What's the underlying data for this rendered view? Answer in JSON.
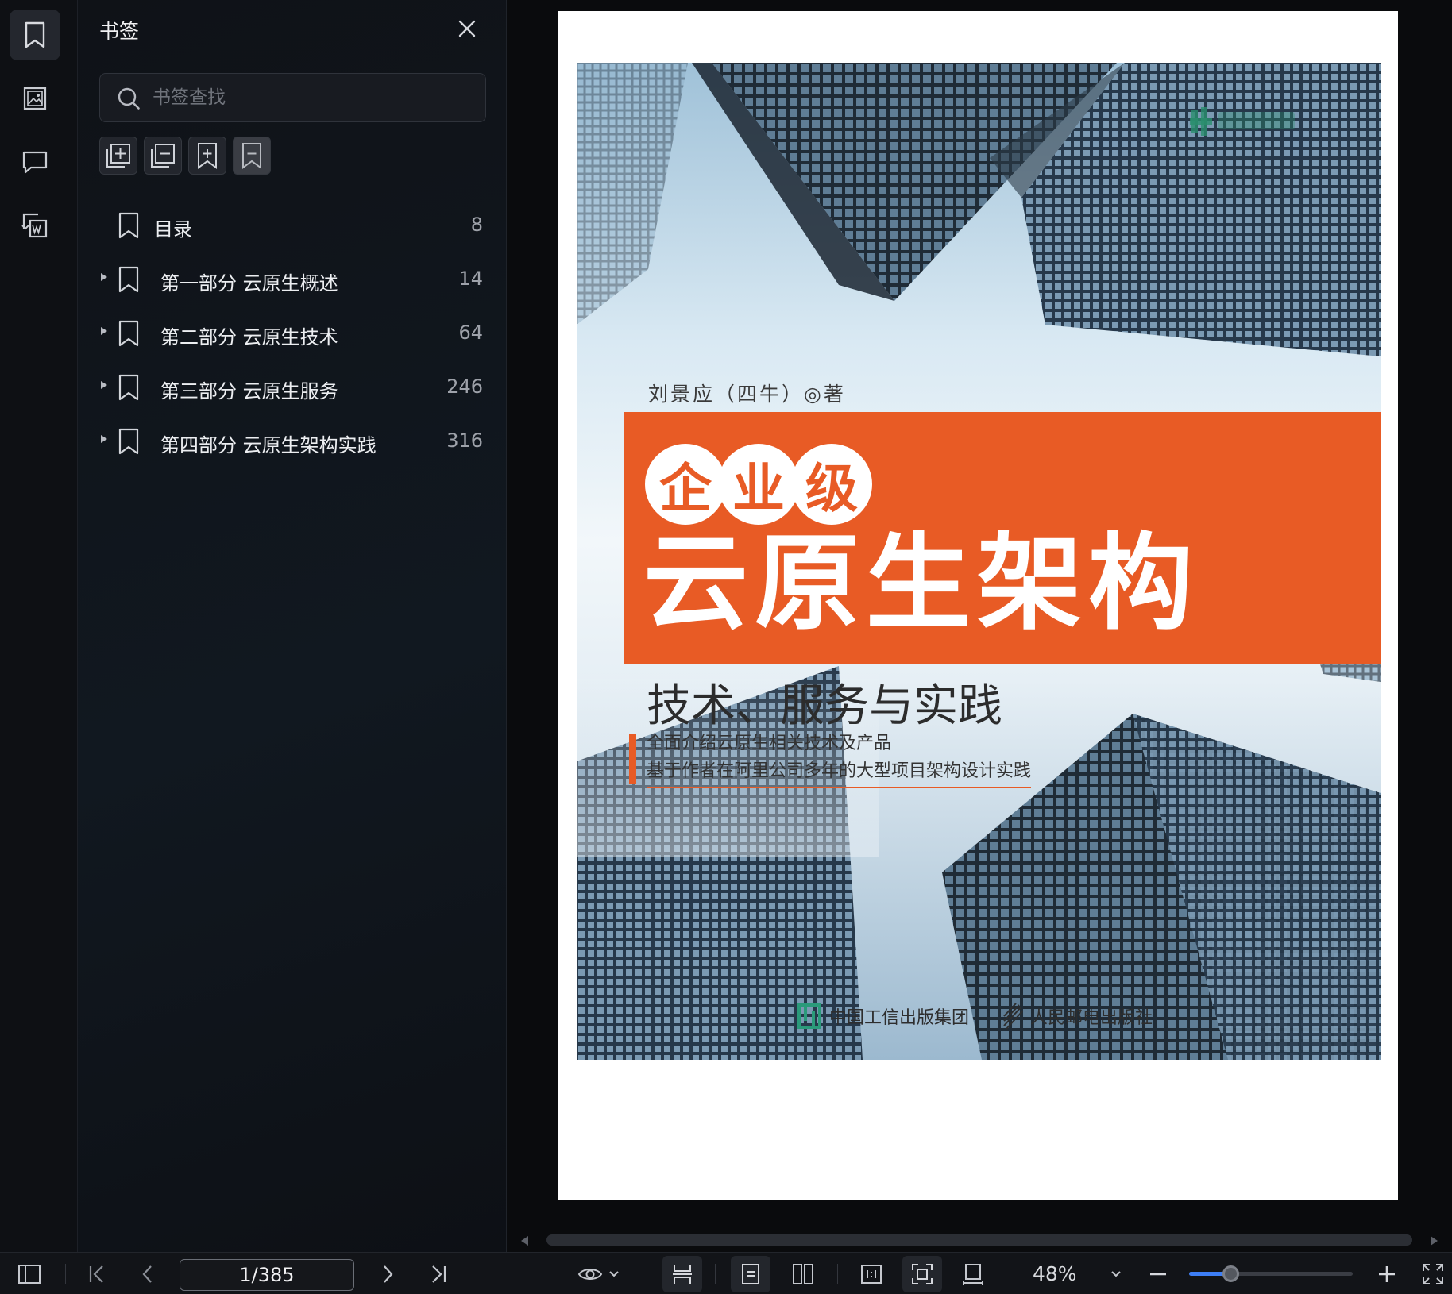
{
  "sidebar_rail": {
    "items": [
      {
        "name": "bookmark-icon",
        "active": true
      },
      {
        "name": "image-icon",
        "active": false
      },
      {
        "name": "comment-icon",
        "active": false
      },
      {
        "name": "convert-to-word-icon",
        "active": false
      }
    ]
  },
  "bookmark_panel": {
    "title": "书签",
    "search": {
      "placeholder": "书签查找",
      "value": ""
    },
    "tools": [
      "add-bookmark-icon",
      "remove-bookmark-icon",
      "insert-bookmark-icon",
      "collapse-bookmark-icon"
    ],
    "items": [
      {
        "label": "目录",
        "page": "8",
        "expandable": false
      },
      {
        "label": "第一部分 云原生概述",
        "page": "14",
        "expandable": true
      },
      {
        "label": "第二部分 云原生技术",
        "page": "64",
        "expandable": true
      },
      {
        "label": "第三部分 云原生服务",
        "page": "246",
        "expandable": true
      },
      {
        "label": "第四部分 云原生架构实践",
        "page": "316",
        "expandable": true
      }
    ]
  },
  "cover": {
    "author": "刘景应（四牛）◎著",
    "circle_chars": [
      "企",
      "业",
      "级"
    ],
    "title": "云原生架构",
    "subtitle": "技术、服务与实践",
    "taglines": [
      "全面介绍云原生相关技术及产品",
      "基于作者在阿里公司多年的大型项目架构设计实践"
    ],
    "publisher_left": "中国工信出版集团",
    "publisher_right": "人民邮电出版社",
    "accent_color": "#e85b25"
  },
  "toolbar": {
    "page_indicator": "1/385",
    "zoom_level": "48%",
    "zoom_fraction": 0.25
  }
}
